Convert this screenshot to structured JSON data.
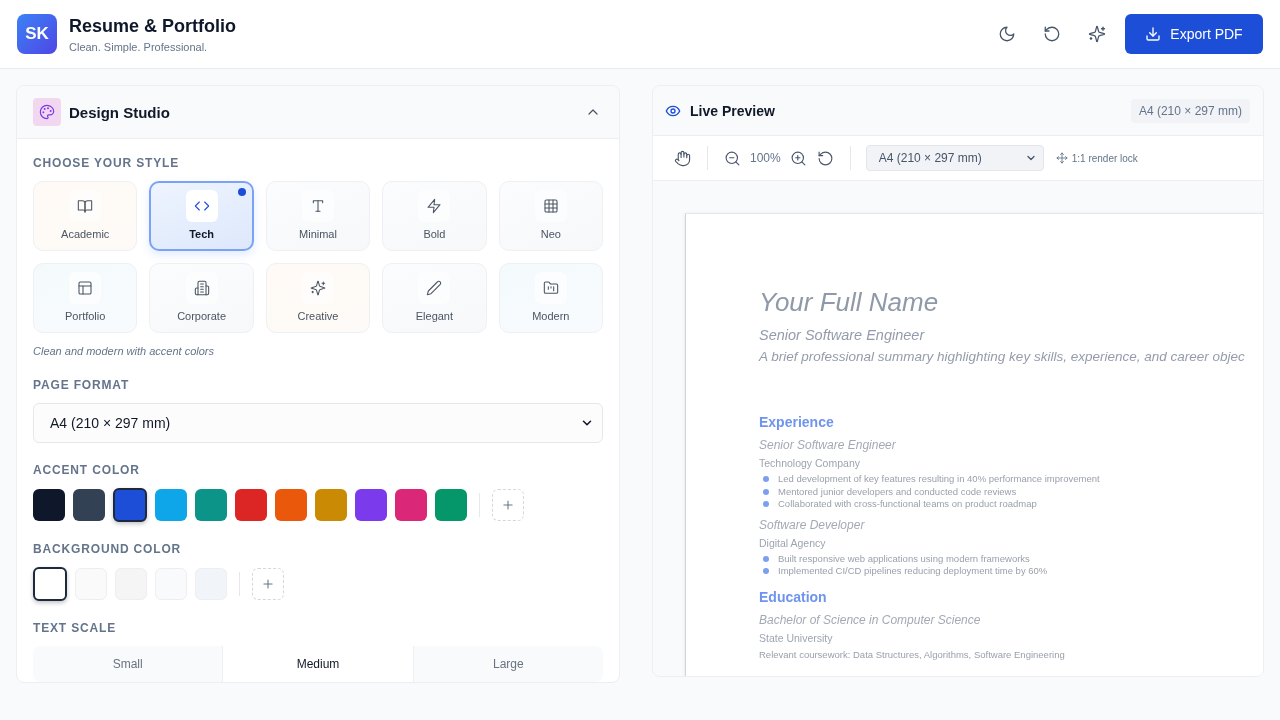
{
  "app": {
    "logo": "SK",
    "title": "Resume & Portfolio",
    "tagline": "Clean. Simple. Professional.",
    "export_button": "Export PDF"
  },
  "design_studio": {
    "title": "Design Studio",
    "expanded": true,
    "style_label": "CHOOSE YOUR STYLE",
    "styles": [
      {
        "label": "Academic",
        "selected": false
      },
      {
        "label": "Tech",
        "selected": true
      },
      {
        "label": "Minimal",
        "selected": false
      },
      {
        "label": "Bold",
        "selected": false
      },
      {
        "label": "Neo",
        "selected": false
      },
      {
        "label": "Portfolio",
        "selected": false
      },
      {
        "label": "Corporate",
        "selected": false
      },
      {
        "label": "Creative",
        "selected": false
      },
      {
        "label": "Elegant",
        "selected": false
      },
      {
        "label": "Modern",
        "selected": false
      }
    ],
    "style_description": "Clean and modern with accent colors",
    "page_format_label": "PAGE FORMAT",
    "page_format": "A4 (210 × 297 mm)",
    "accent_label": "ACCENT COLOR",
    "accent_colors": [
      {
        "color": "#0f172a",
        "selected": false
      },
      {
        "color": "#334155",
        "selected": false
      },
      {
        "color": "#1d4ed8",
        "selected": true
      },
      {
        "color": "#0ea5e9",
        "selected": false
      },
      {
        "color": "#0d9488",
        "selected": false
      },
      {
        "color": "#dc2626",
        "selected": false
      },
      {
        "color": "#ea580c",
        "selected": false
      },
      {
        "color": "#ca8a04",
        "selected": false
      },
      {
        "color": "#7c3aed",
        "selected": false
      },
      {
        "color": "#db2777",
        "selected": false
      },
      {
        "color": "#059669",
        "selected": false
      }
    ],
    "background_label": "BACKGROUND COLOR",
    "background_colors": [
      {
        "color": "#ffffff",
        "selected": true
      },
      {
        "color": "#fafafa",
        "selected": false
      },
      {
        "color": "#f5f5f5",
        "selected": false
      },
      {
        "color": "#f8fafc",
        "selected": false
      },
      {
        "color": "#f1f5f9",
        "selected": false
      }
    ],
    "text_scale_label": "TEXT SCALE",
    "text_scales": [
      {
        "label": "Small",
        "selected": false
      },
      {
        "label": "Medium",
        "selected": true
      },
      {
        "label": "Large",
        "selected": false
      }
    ]
  },
  "live_preview": {
    "title": "Live Preview",
    "format_badge": "A4 (210 × 297 mm)",
    "zoom": "100%",
    "format_select": "A4 (210 × 297 mm)",
    "render_lock": "1:1 render lock",
    "resume": {
      "name": "Your Full Name",
      "headline": "Senior Software Engineer",
      "summary": "A brief professional summary highlighting key skills, experience, and career objec",
      "sections": [
        {
          "heading": "Experience",
          "entries": [
            {
              "title": "Senior Software Engineer",
              "subtitle": "Technology Company",
              "bullets": [
                "Led development of key features resulting in 40% performance improvement",
                "Mentored junior developers and conducted code reviews",
                "Collaborated with cross-functional teams on product roadmap"
              ]
            },
            {
              "title": "Software Developer",
              "subtitle": "Digital Agency",
              "bullets": [
                "Built responsive web applications using modern frameworks",
                "Implemented CI/CD pipelines reducing deployment time by 60%"
              ]
            }
          ]
        },
        {
          "heading": "Education",
          "entries": [
            {
              "title": "Bachelor of Science in Computer Science",
              "subtitle": "State University",
              "details": "Relevant coursework: Data Structures, Algorithms, Software Engineering"
            }
          ]
        }
      ]
    }
  }
}
